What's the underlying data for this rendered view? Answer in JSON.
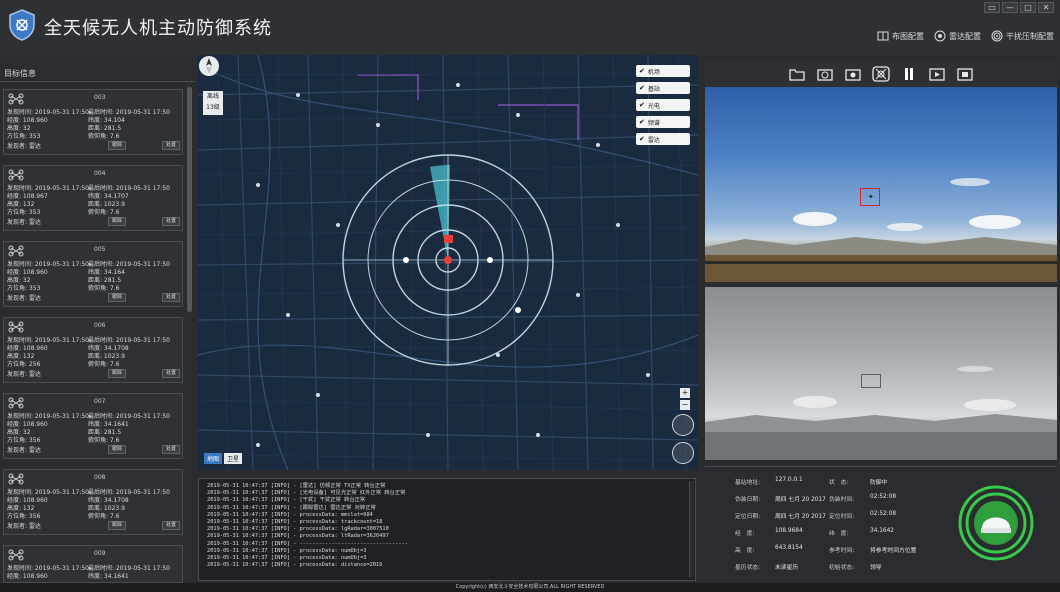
{
  "app": {
    "title": "全天候无人机主动防御系统",
    "window_controls": [
      "▭",
      "—",
      "□",
      "✕"
    ]
  },
  "top_actions": [
    {
      "label": "布图配置",
      "icon": "map-book-icon"
    },
    {
      "label": "雷达配置",
      "icon": "target-icon"
    },
    {
      "label": "干扰压制配置",
      "icon": "signal-icon"
    }
  ],
  "left_panel": {
    "title": "目标信息",
    "cards": [
      {
        "id": "003",
        "find_time": "2019-05-31 17:50",
        "last_time": "2019-05-31 17:50",
        "lon": "108.960",
        "lat": "34.104",
        "height": "32",
        "dist": "281.5",
        "azimuth": "353",
        "pitch": "7.6",
        "by": "雷达",
        "locate": "跟踪",
        "btn": "处置"
      },
      {
        "id": "004",
        "find_time": "2019-05-31 17:50",
        "last_time": "2019-05-31 17:50",
        "lon": "108.967",
        "lat": "34.1707",
        "height": "132",
        "dist": "1023.9",
        "azimuth": "353",
        "pitch": "7.6",
        "by": "雷达",
        "locate": "跟踪",
        "btn": "处置"
      },
      {
        "id": "005",
        "find_time": "2019-05-31 17:50",
        "last_time": "2019-05-31 17:50",
        "lon": "108.960",
        "lat": "34.164",
        "height": "32",
        "dist": "281.5",
        "azimuth": "353",
        "pitch": "7.6",
        "by": "雷达",
        "locate": "跟踪",
        "btn": "处置"
      },
      {
        "id": "006",
        "find_time": "2019-05-31 17:50",
        "last_time": "2019-05-31 17:50",
        "lon": "108.960",
        "lat": "34.1708",
        "height": "132",
        "dist": "1023.9",
        "azimuth": "256",
        "pitch": "7.6",
        "by": "雷达",
        "locate": "跟踪",
        "btn": "处置"
      },
      {
        "id": "007",
        "find_time": "2019-05-31 17:50",
        "last_time": "2019-05-31 17:50",
        "lon": "108.960",
        "lat": "34.1641",
        "height": "32",
        "dist": "281.5",
        "azimuth": "356",
        "pitch": "7.6",
        "by": "雷达",
        "locate": "跟踪",
        "btn": "处置"
      },
      {
        "id": "008",
        "find_time": "2019-05-31 17:50",
        "last_time": "2019-05-31 17:50",
        "lon": "108.960",
        "lat": "34.1708",
        "height": "132",
        "dist": "1023.9",
        "azimuth": "356",
        "pitch": "7.6",
        "by": "雷达",
        "locate": "跟踪",
        "btn": "处置"
      },
      {
        "id": "009",
        "find_time": "2019-05-31 17:50",
        "last_time": "2019-05-31 17:50",
        "lon": "108.960",
        "lat": "34.1641",
        "height": "",
        "dist": "",
        "azimuth": "",
        "pitch": "",
        "by": "",
        "locate": "",
        "btn": ""
      }
    ],
    "labels": {
      "find_time": "发现时间:",
      "last_time": "最后时间:",
      "lon": "经度:",
      "lat": "纬度:",
      "height": "高度:",
      "dist": "距离:",
      "azimuth": "方位角:",
      "pitch": "俯仰角:",
      "by": "发现者:"
    }
  },
  "map": {
    "level_label": "离线",
    "level_value": "13级",
    "layers": [
      {
        "label": "机场",
        "checked": true
      },
      {
        "label": "基站",
        "checked": true
      },
      {
        "label": "光电",
        "checked": true
      },
      {
        "label": "频谱",
        "checked": true
      },
      {
        "label": "雷达",
        "checked": true
      }
    ],
    "bottom_tabs": [
      "地图",
      "卫星"
    ],
    "zoom": [
      "+",
      "−"
    ]
  },
  "log": {
    "lines": [
      "2019-05-31 10:47:37 [INFO] - [雷达]  仿频正常 TX正常 转台正常",
      "2019-05-31 10:47:37 [INFO] - [光电设备] 可见光正常 红外正常 转台正常",
      "2019-05-31 10:47:37 [INFO] - [干扰]  干扰正常 转台正常",
      "2019-05-31 10:47:37 [INFO] - [跟踪雷达]  雷达正常 对转正常",
      "2019-05-31 10:47:37 [INFO] - processData: mmclat=984",
      "2019-05-31 10:47:37 [INFO] - processData: trackcount=18",
      "2019-05-31 10:47:37 [INFO] - processData: lgRadar=3007510",
      "2019-05-31 10:47:37 [INFO] - processData: ltRadar=3620497",
      "2019-05-31 10:47:37 [INFO] - ----------------------------------",
      "2019-05-31 10:47:37 [INFO] - processData: numObj=3",
      "2019-05-31 10:47:37 [INFO] - processData: numObj=3",
      "2019-05-31 10:47:37 [INFO] - processData: distance=2016"
    ]
  },
  "camera_toolbar": [
    "folder-icon",
    "camera-icon",
    "photo-icon",
    "drone-target-icon",
    "pause-icon",
    "play-record-icon",
    "stop-record-icon"
  ],
  "status": {
    "rows": [
      {
        "k1": "基站地址:",
        "v1": "127.0.0.1",
        "k2": "状　态:",
        "v2": "防御中"
      },
      {
        "k1": "伪装日期:",
        "v1": "周四 七月 20 2017",
        "k2": "伪装时间:",
        "v2": "02:52:08"
      },
      {
        "k1": "定位日期:",
        "v1": "周四 七月 20 2017",
        "k2": "定位时间:",
        "v2": "02:52:08"
      },
      {
        "k1": "经　度:",
        "v1": "108.9684",
        "k2": "纬　度:",
        "v2": "34.1642"
      },
      {
        "k1": "高　度:",
        "v1": "643.8154",
        "k2": "参考时间:",
        "v2": "将参考时间方位置"
      },
      {
        "k1": "星历状态:",
        "v1": "未读星历",
        "k2": "初始状态:",
        "v2": "领导"
      }
    ]
  },
  "footer": "Copyright(c) 西安北斗安全技术有限公司.ALL RIGHT RESERVED",
  "colors": {
    "radar_green": "#36c94a",
    "target_red": "#d6262a",
    "map_bg": "#1b2b3f",
    "radar_ring": "#cfe7f2"
  }
}
